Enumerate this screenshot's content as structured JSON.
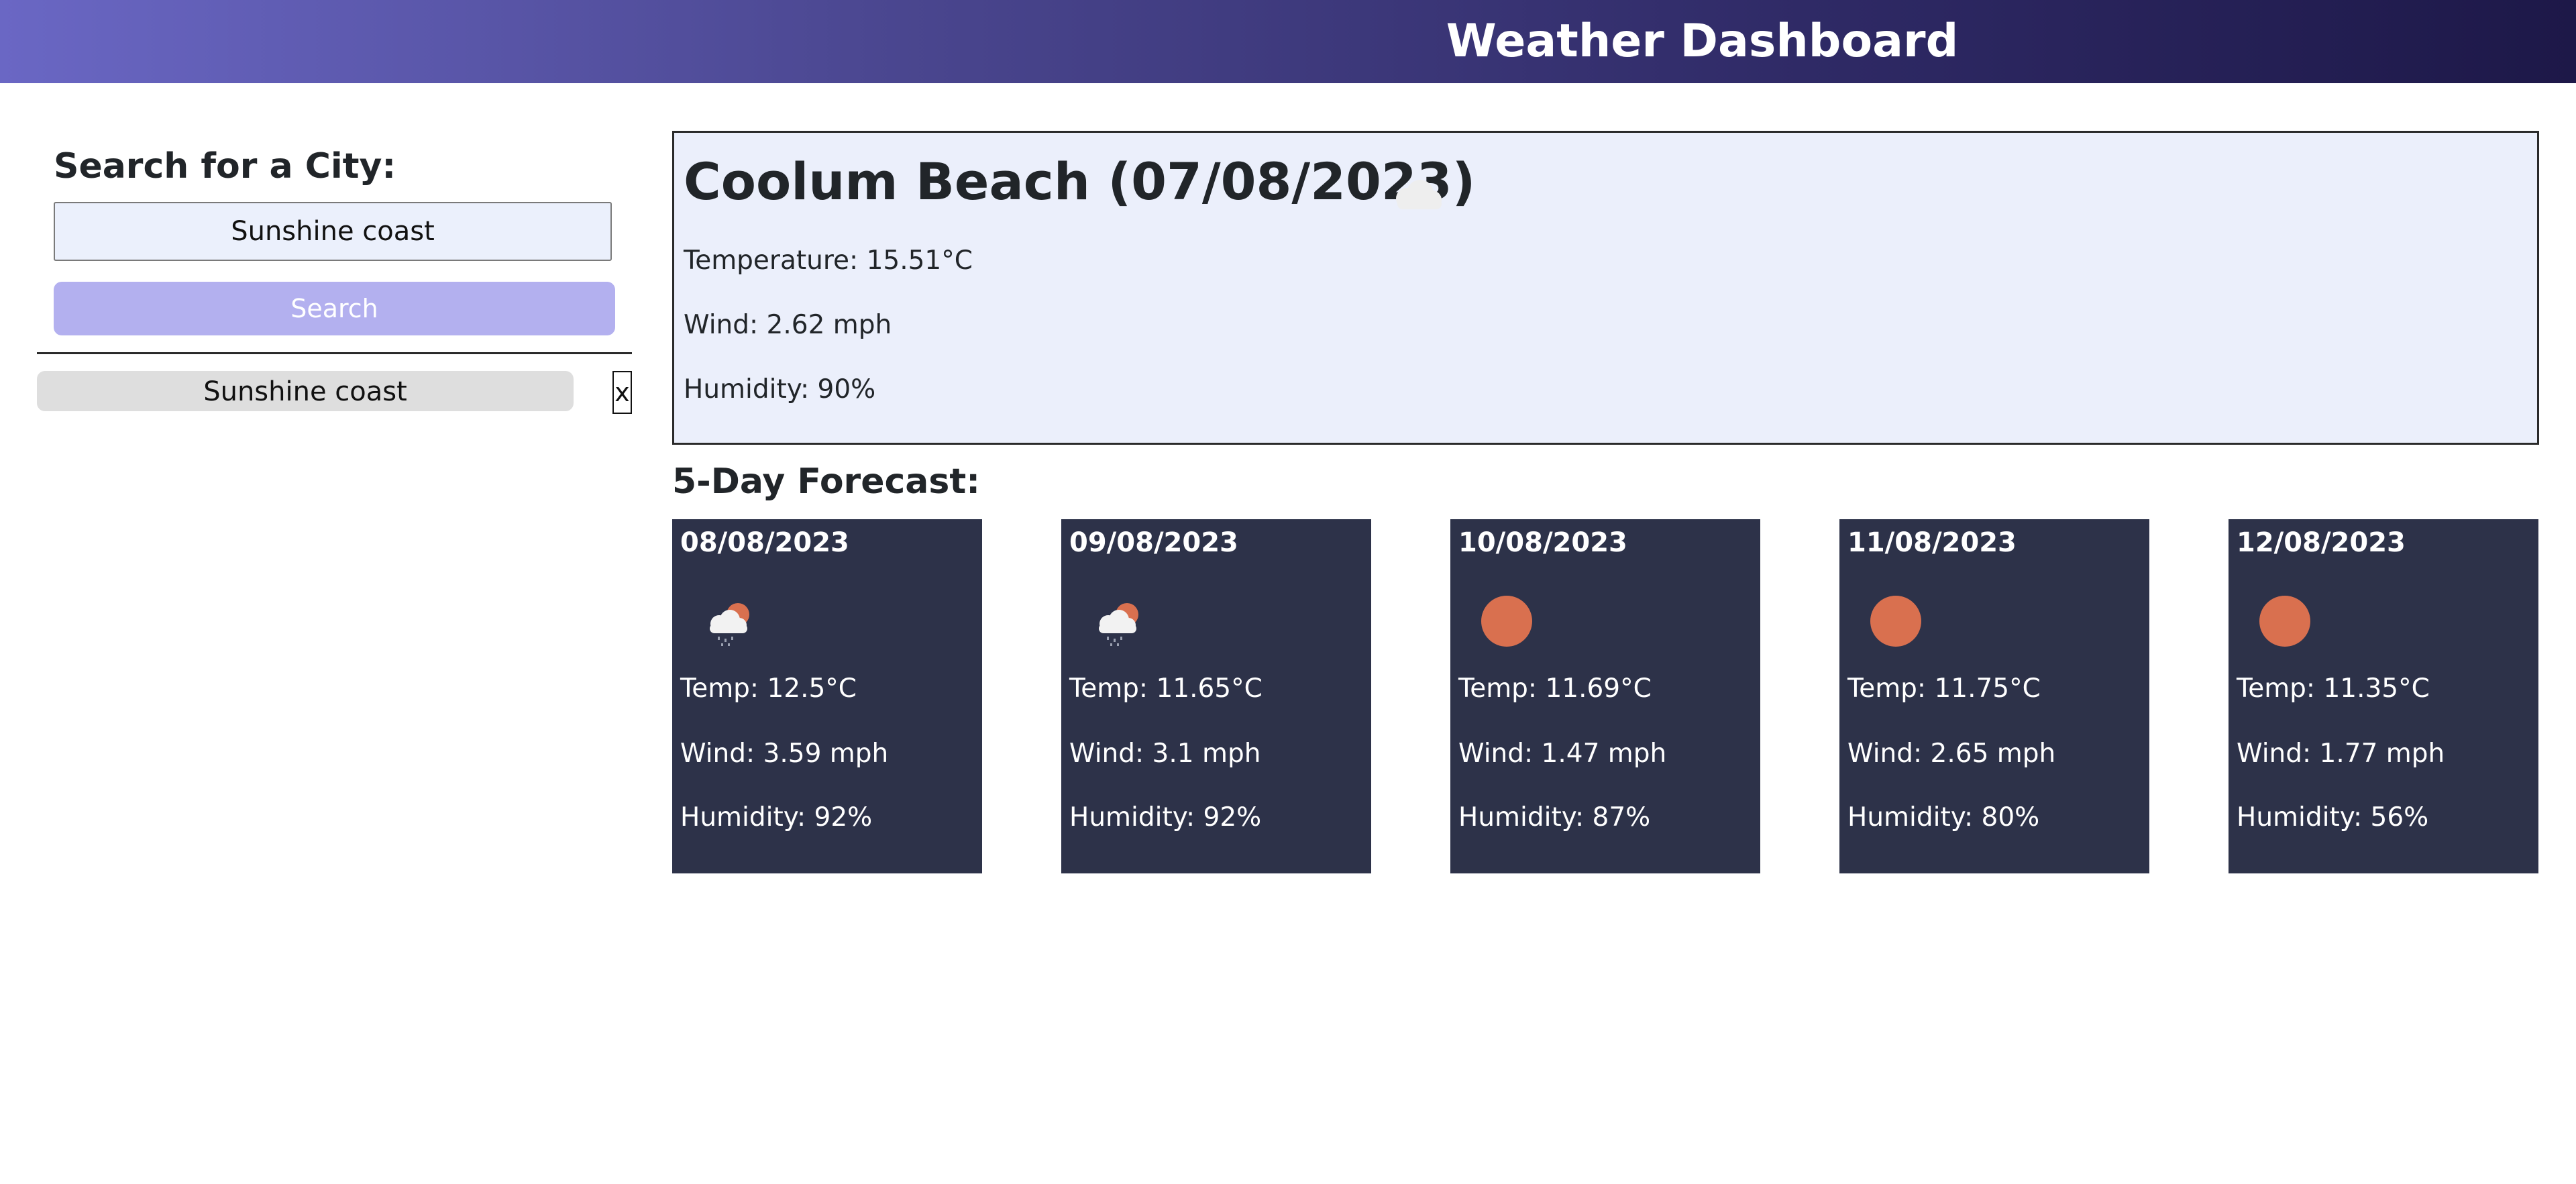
{
  "header": {
    "title": "Weather Dashboard"
  },
  "sidebar": {
    "heading": "Search for a City:",
    "search_value": "Sunshine coast",
    "search_button_label": "Search",
    "history": [
      {
        "label": "Sunshine coast",
        "remove_label": "x"
      }
    ]
  },
  "current": {
    "title": "Coolum Beach (07/08/2023)",
    "icon": "cloud-icon",
    "temperature": "Temperature: 15.51°C",
    "wind": "Wind: 2.62 mph",
    "humidity": "Humidity: 90%"
  },
  "forecast": {
    "heading": "5-Day Forecast:",
    "days": [
      {
        "date": "08/08/2023",
        "icon": "cloud-sun-rain-icon",
        "temp": "Temp: 12.5°C",
        "wind": "Wind: 3.59 mph",
        "humidity": "Humidity: 92%"
      },
      {
        "date": "09/08/2023",
        "icon": "cloud-sun-rain-icon",
        "temp": "Temp: 11.65°C",
        "wind": "Wind: 3.1 mph",
        "humidity": "Humidity: 92%"
      },
      {
        "date": "10/08/2023",
        "icon": "sun-icon",
        "temp": "Temp: 11.69°C",
        "wind": "Wind: 1.47 mph",
        "humidity": "Humidity: 87%"
      },
      {
        "date": "11/08/2023",
        "icon": "sun-icon",
        "temp": "Temp: 11.75°C",
        "wind": "Wind: 2.65 mph",
        "humidity": "Humidity: 80%"
      },
      {
        "date": "12/08/2023",
        "icon": "sun-icon",
        "temp": "Temp: 11.35°C",
        "wind": "Wind: 1.77 mph",
        "humidity": "Humidity: 56%"
      }
    ]
  },
  "colors": {
    "header_gradient_start": "#6a67c4",
    "header_gradient_end": "#1d1848",
    "search_button": "#b3b0ef",
    "current_panel_bg": "#ebeffb",
    "forecast_card_bg": "#2d3249",
    "sun": "#d9704f"
  }
}
